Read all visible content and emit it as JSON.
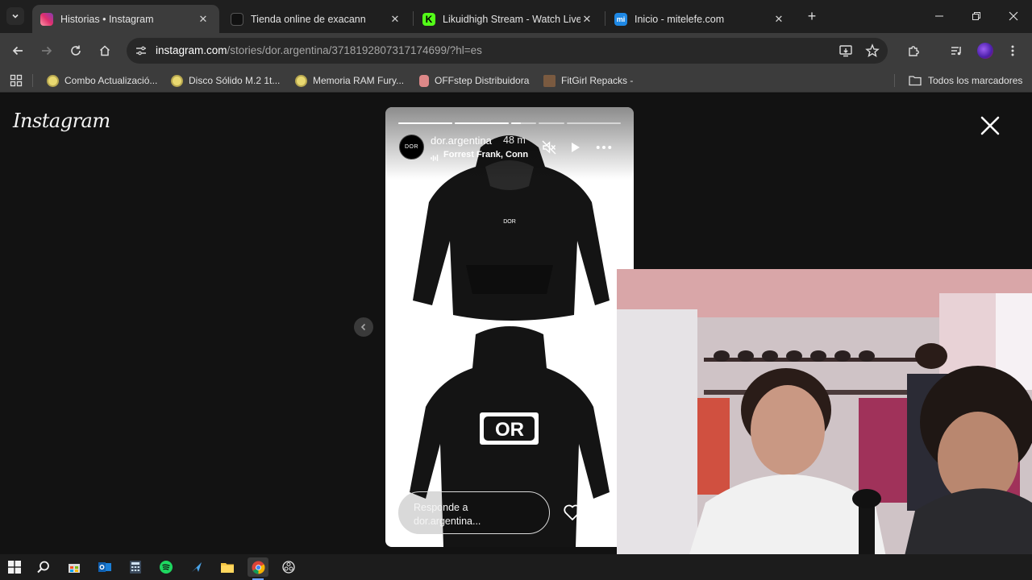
{
  "tabs": [
    {
      "title": "Historias • Instagram",
      "active": true,
      "favicon_color": "#e1306c"
    },
    {
      "title": "Tienda online de exacann",
      "active": false,
      "favicon_color": "#111111"
    },
    {
      "title": "Likuidhigh Stream - Watch Live",
      "active": false,
      "favicon_color": "#53fc18"
    },
    {
      "title": "Inicio - mitelefe.com",
      "active": false,
      "favicon_color": "#1e88e5"
    }
  ],
  "address": {
    "host": "instagram.com",
    "path": "/stories/dor.argentina/3718192807317174699/?hl=es"
  },
  "bookmarks": [
    {
      "label": "Combo Actualizació...",
      "icon_color": "#d8c89a"
    },
    {
      "label": "Disco Sólido M.2 1t...",
      "icon_color": "#d8c89a"
    },
    {
      "label": "Memoria RAM Fury...",
      "icon_color": "#d8c89a"
    },
    {
      "label": "OFFstep Distribuidora",
      "icon_color": "#c77"
    },
    {
      "label": "FitGirl Repacks -",
      "icon_color": "#8a6a4a"
    }
  ],
  "all_bookmarks": "Todos los marcadores",
  "page": {
    "logo": "Instagram"
  },
  "story": {
    "username": "dor.argentina",
    "time": "48 m",
    "music": "Forrest Frank, Conn",
    "avatar_text": "DOR",
    "brand_front": "DOR",
    "brand_back": "OR",
    "reply_placeholder": "Responde a dor.argentina...",
    "progress": [
      1,
      1,
      0.4,
      0,
      0
    ]
  }
}
